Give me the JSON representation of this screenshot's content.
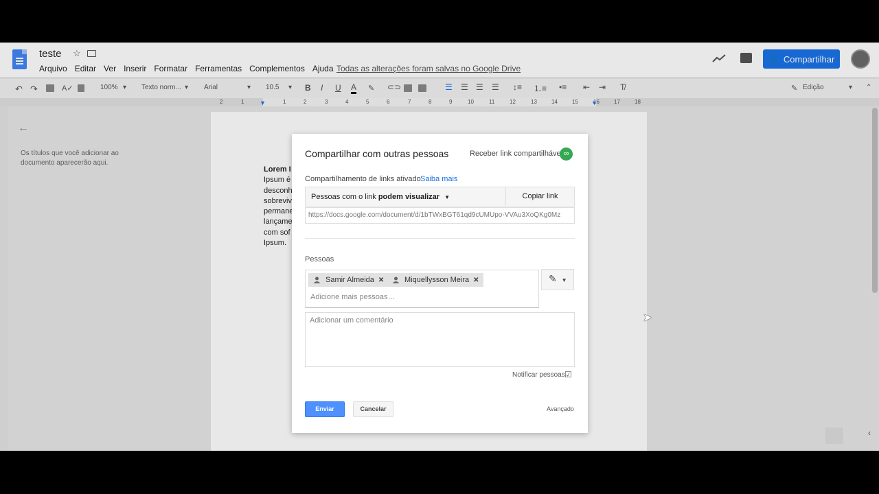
{
  "header": {
    "doc_title": "teste",
    "menu": [
      "Arquivo",
      "Editar",
      "Ver",
      "Inserir",
      "Formatar",
      "Ferramentas",
      "Complementos",
      "Ajuda"
    ],
    "saved_status": "Todas as alterações foram salvas no Google Drive",
    "share_label": "Compartilhar",
    "brand_color": "#1a73e8"
  },
  "toolbar": {
    "zoom": "100%",
    "style": "Texto norm...",
    "font": "Arial",
    "size": "10.5",
    "mode": "Edição",
    "icons": [
      "undo-icon",
      "redo-icon",
      "print-icon",
      "spellcheck-icon",
      "paint-format-icon",
      "bold-icon",
      "italic-icon",
      "underline-icon",
      "text-color-icon",
      "highlight-icon",
      "link-icon",
      "comment-add-icon",
      "image-icon",
      "align-left-icon",
      "align-center-icon",
      "align-right-icon",
      "justify-icon",
      "line-spacing-icon",
      "numbered-list-icon",
      "bulleted-list-icon",
      "indent-decrease-icon",
      "indent-increase-icon",
      "clear-format-icon"
    ]
  },
  "ruler": {
    "ticks": [
      "2",
      "1",
      "1",
      "2",
      "3",
      "4",
      "5",
      "6",
      "7",
      "8",
      "9",
      "10",
      "11",
      "12",
      "13",
      "14",
      "15",
      "16",
      "17",
      "18"
    ]
  },
  "outline": {
    "hint": "Os títulos que você adicionar ao documento aparecerão aqui."
  },
  "document": {
    "heading": "Lorem I",
    "lines": [
      "Ipsum é",
      "desconh",
      "sobreviv",
      "permane",
      "lançame",
      "com sof",
      "Ipsum."
    ]
  },
  "dialog": {
    "title": "Compartilhar com outras pessoas",
    "get_link": "Receber link compartilhável",
    "link_status": "Compartilhamento de links ativado",
    "learn_more": "Saiba mais",
    "permission_prefix": "Pessoas com o link",
    "permission_value": "podem visualizar",
    "copy_link": "Copiar link",
    "url": "https://docs.google.com/document/d/1bTWxBGT61qd9cUMUpo-VVAu3XoQKg0Mz",
    "people_label": "Pessoas",
    "people": [
      "Samir Almeida",
      "Miquellysson Meira"
    ],
    "add_people_placeholder": "Adicione mais pessoas…",
    "comment_placeholder": "Adicionar um comentário",
    "notify": "Notificar pessoas",
    "notify_checked": true,
    "send": "Enviar",
    "cancel": "Cancelar",
    "advanced": "Avançado",
    "send_color": "#4d90fe",
    "link_badge_color": "#34a853"
  }
}
